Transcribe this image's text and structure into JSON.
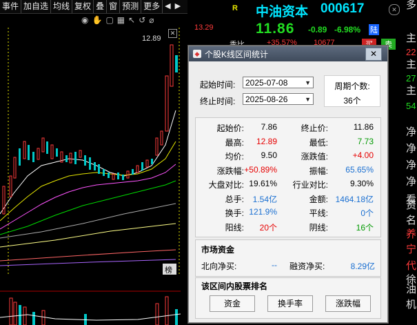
{
  "toolbar": {
    "items": [
      "事件",
      "加自选",
      "均线",
      "复权",
      "叠",
      "窗",
      "预测",
      "更多"
    ],
    "arrow_left": "◀",
    "arrow_right": "▶"
  },
  "chart": {
    "price_high_label": "12.89",
    "right_axis_top": "13.29",
    "corner_badge": "榜"
  },
  "stock": {
    "name": "中油资本",
    "code": "000617",
    "price": "11.86",
    "change": "-0.89",
    "change_pct": "-6.98%",
    "market": "陆",
    "r_badge": "R",
    "sub_a": "+35.57%",
    "sub_b": "10677",
    "sub_c": "季比",
    "btn_buy": "买",
    "btn_sell": "卖"
  },
  "side": {
    "chars": [
      "多",
      "主",
      "22",
      "主",
      "27",
      "主",
      "54",
      "净",
      "净",
      "净",
      "净",
      "看",
      "资",
      "名",
      "养",
      "宁",
      "代",
      "徐",
      "油",
      "机"
    ]
  },
  "dialog": {
    "title": "个股K线区间统计",
    "close": "✕",
    "start_label": "起始时间:",
    "start_value": "2025-07-08",
    "end_label": "终止时间:",
    "end_value": "2025-08-26",
    "period_label": "周期个数:",
    "period_value": "36个",
    "stats": [
      {
        "k1": "起始价:",
        "v1": "7.86",
        "c1": "black",
        "k2": "终止价:",
        "v2": "11.86",
        "c2": "black"
      },
      {
        "k1": "最高:",
        "v1": "12.89",
        "c1": "red",
        "k2": "最低:",
        "v2": "7.73",
        "c2": "green"
      },
      {
        "k1": "均价:",
        "v1": "9.50",
        "c1": "black",
        "k2": "涨跌值:",
        "v2": "+4.00",
        "c2": "red"
      },
      {
        "k1": "涨跌幅:",
        "v1": "+50.89%",
        "c1": "red",
        "k2": "振幅:",
        "v2": "65.65%",
        "c2": "blue"
      },
      {
        "k1": "大盘对比:",
        "v1": "19.61%",
        "c1": "black",
        "k2": "行业对比:",
        "v2": "9.30%",
        "c2": "black"
      },
      {
        "k1": "总手:",
        "v1": "1.54亿",
        "c1": "blue",
        "k2": "金额:",
        "v2": "1464.18亿",
        "c2": "blue"
      },
      {
        "k1": "换手:",
        "v1": "121.9%",
        "c1": "blue",
        "k2": "平线:",
        "v2": "0个",
        "c2": "blue"
      },
      {
        "k1": "阳线:",
        "v1": "20个",
        "c1": "red",
        "k2": "阴线:",
        "v2": "16个",
        "c2": "green"
      }
    ],
    "market_funds_title": "市场资金",
    "north_label": "北向净买:",
    "north_value": "--",
    "margin_label": "融资净买:",
    "margin_value": "8.29亿",
    "rank_title": "该区间内股票排名",
    "rank_buttons": [
      "资金",
      "换手率",
      "涨跌幅"
    ]
  },
  "colors": {
    "up": "#ff3b3b",
    "down": "#00c8c8",
    "bg": "#000000",
    "stock_title": "#00e5ff",
    "price_green": "#22dd22"
  }
}
